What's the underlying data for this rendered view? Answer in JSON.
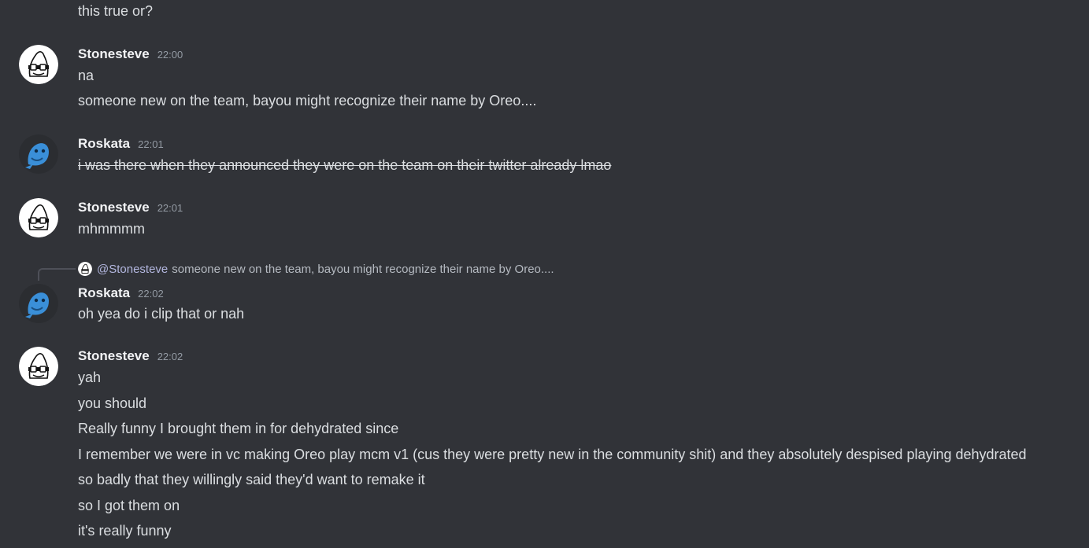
{
  "messages": [
    {
      "continuation": "this true or?"
    },
    {
      "author": "Stonesteve",
      "avatar_icon": "stonesteve-avatar-icon",
      "time": "22:00",
      "lines": [
        "na",
        "someone new on the team, bayou might recognize their name by Oreo...."
      ]
    },
    {
      "author": "Roskata",
      "avatar_icon": "roskata-avatar-icon",
      "time": "22:01",
      "lines": [
        "i was there when they announced they were on the team on their twitter already lmao"
      ],
      "strikethrough": true
    },
    {
      "author": "Stonesteve",
      "avatar_icon": "stonesteve-avatar-icon",
      "time": "22:01",
      "lines": [
        "mhmmmm"
      ]
    },
    {
      "reply": {
        "mention": "@Stonesteve",
        "text": "someone new on the team, bayou might recognize their name by Oreo...."
      },
      "author": "Roskata",
      "avatar_icon": "roskata-avatar-icon",
      "time": "22:02",
      "lines": [
        "oh yea do i clip that or nah"
      ]
    },
    {
      "author": "Stonesteve",
      "avatar_icon": "stonesteve-avatar-icon",
      "time": "22:02",
      "lines": [
        "yah",
        "you should",
        "Really funny I brought them in for dehydrated since",
        "I remember we were in vc making Oreo play mcm v1 (cus they were pretty new in the community shit) and they absolutely despised playing dehydrated",
        "so badly that they willingly said they'd want to remake it",
        "so I got them on",
        "it's really funny"
      ]
    }
  ],
  "colors": {
    "background": "#313338",
    "text": "#dbdee1",
    "author": "#f2f3f5",
    "timestamp": "#949ba4",
    "roskata_avatar": "#3a8fd8",
    "stonesteve_avatar": "#ffffff"
  }
}
